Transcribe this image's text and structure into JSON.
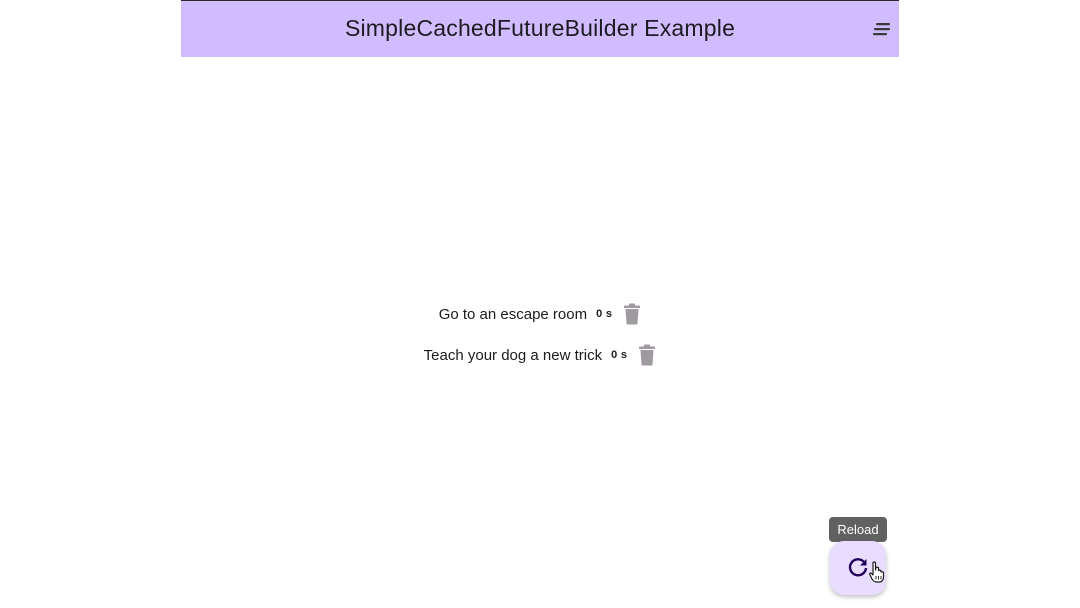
{
  "app_bar": {
    "title": "SimpleCachedFutureBuilder Example",
    "menu_icon": "menu-lines-icon",
    "background": "#d1bcff"
  },
  "items": [
    {
      "label": "Go to an escape room",
      "time": "0 s",
      "icon": "trash-icon"
    },
    {
      "label": "Teach your dog a new trick",
      "time": "0 s",
      "icon": "trash-icon"
    }
  ],
  "fab": {
    "tooltip": "Reload",
    "icon": "refresh-icon",
    "background": "#e9ddff"
  }
}
